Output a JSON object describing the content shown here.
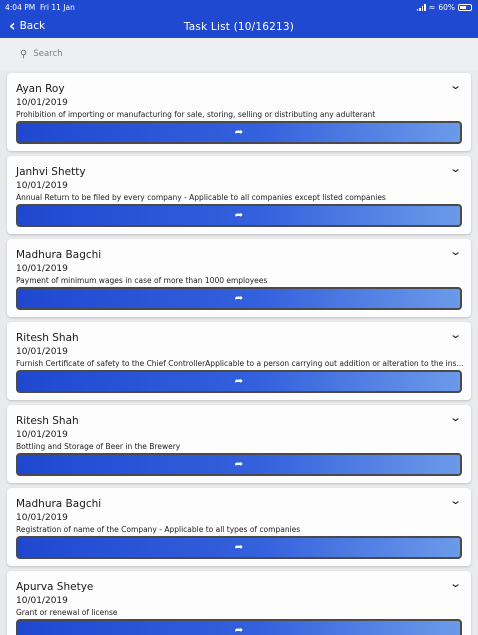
{
  "status_bar": {
    "time": "4:04 PM",
    "date": "Fri 11 Jan",
    "battery": "60%",
    "battery_level": 0.6
  },
  "nav": {
    "back_label": "Back",
    "title": "Task List (10/16213)"
  },
  "search": {
    "placeholder": "Search"
  },
  "colors": {
    "header": "#1f49d1",
    "button_start": "#1f48d0",
    "button_end": "#6c9ae9"
  },
  "icons": {
    "back": "chevron-left-icon",
    "expand": "chevron-down-icon",
    "action": "share-forward-icon",
    "search": "search-icon"
  },
  "tasks": [
    {
      "name": "Ayan Roy",
      "date": "10/01/2019",
      "description": "Prohibition of importing or manufacturing for sale, storing, selling or distributing any adulterant"
    },
    {
      "name": "Janhvi Shetty",
      "date": "10/01/2019",
      "description": "Annual Return to be filed by every company - Applicable to all companies except listed companies"
    },
    {
      "name": "Madhura Bagchi",
      "date": "10/01/2019",
      "description": "Payment of minimum wages in case of more than 1000 employees"
    },
    {
      "name": "Ritesh Shah",
      "date": "10/01/2019",
      "description": "Furnish Certificate of safety to the Chief ControllerApplicable to a person carrying out addition or alteration to the ins..."
    },
    {
      "name": "Ritesh Shah",
      "date": "10/01/2019",
      "description": "Bottling and Storage of Beer in the Brewery"
    },
    {
      "name": "Madhura Bagchi",
      "date": "10/01/2019",
      "description": "Registration of name of the Company - Applicable to all types of companies"
    },
    {
      "name": "Apurva Shetye",
      "date": "10/01/2019",
      "description": "Grant or renewal of license"
    }
  ]
}
